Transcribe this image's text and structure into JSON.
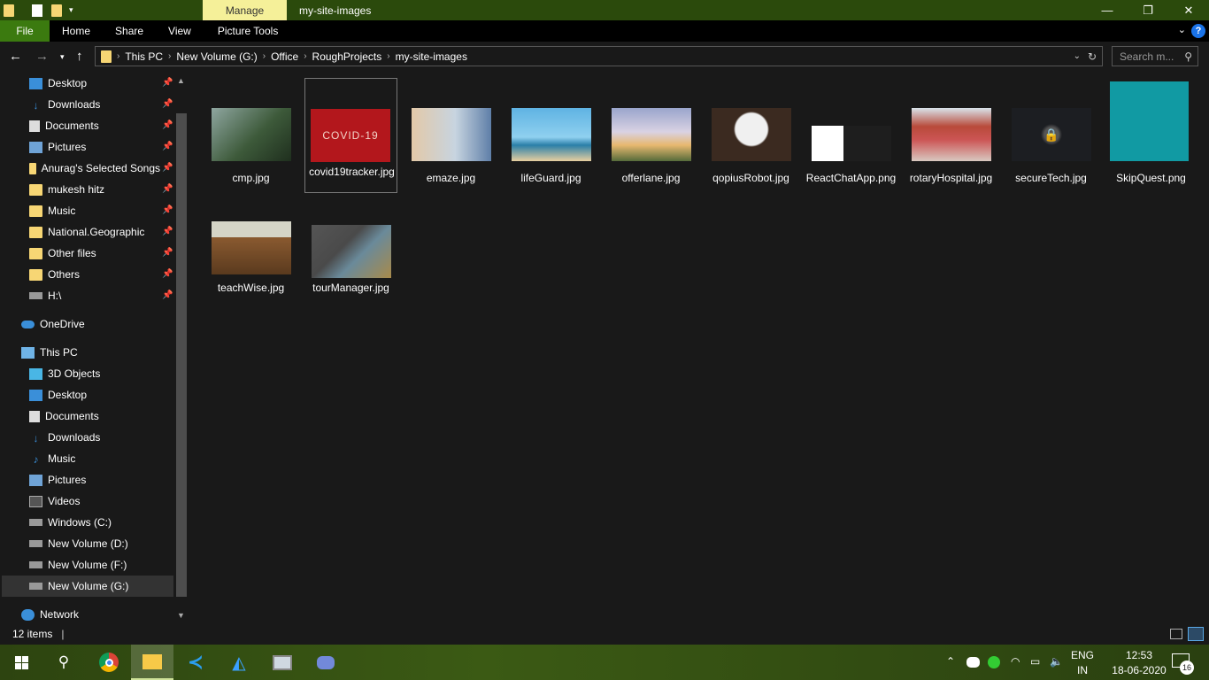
{
  "window": {
    "title": "my-site-images",
    "contextual_tab": "Manage",
    "controls": {
      "minimize": "—",
      "maximize": "❐",
      "close": "✕"
    }
  },
  "ribbon": {
    "tabs": [
      "File",
      "Home",
      "Share",
      "View",
      "Picture Tools"
    ],
    "help": "?"
  },
  "address": {
    "crumbs": [
      "This PC",
      "New Volume (G:)",
      "Office",
      "RoughProjects",
      "my-site-images"
    ],
    "search_placeholder": "Search m..."
  },
  "sidebar": {
    "quick_access": [
      {
        "label": "Desktop",
        "icon": "desktop-icon",
        "pinned": true
      },
      {
        "label": "Downloads",
        "icon": "download-icon",
        "pinned": true
      },
      {
        "label": "Documents",
        "icon": "document-icon",
        "pinned": true
      },
      {
        "label": "Pictures",
        "icon": "pictures-icon",
        "pinned": true
      },
      {
        "label": "Anurag's Selected Songs",
        "icon": "folder-icon",
        "pinned": true
      },
      {
        "label": "mukesh hitz",
        "icon": "folder-icon",
        "pinned": true
      },
      {
        "label": "Music",
        "icon": "folder-icon",
        "pinned": true
      },
      {
        "label": "National.Geographic",
        "icon": "folder-icon",
        "pinned": true
      },
      {
        "label": "Other files",
        "icon": "folder-icon",
        "pinned": true
      },
      {
        "label": "Others",
        "icon": "folder-icon",
        "pinned": true
      },
      {
        "label": "H:\\",
        "icon": "network-drive-icon",
        "pinned": true
      }
    ],
    "onedrive": "OneDrive",
    "this_pc": "This PC",
    "this_pc_items": [
      {
        "label": "3D Objects",
        "icon": "3d-objects-icon"
      },
      {
        "label": "Desktop",
        "icon": "desktop-icon"
      },
      {
        "label": "Documents",
        "icon": "document-icon"
      },
      {
        "label": "Downloads",
        "icon": "download-icon"
      },
      {
        "label": "Music",
        "icon": "music-icon"
      },
      {
        "label": "Pictures",
        "icon": "pictures-icon"
      },
      {
        "label": "Videos",
        "icon": "videos-icon"
      },
      {
        "label": "Windows (C:)",
        "icon": "drive-icon"
      },
      {
        "label": "New Volume (D:)",
        "icon": "drive-icon"
      },
      {
        "label": "New Volume (F:)",
        "icon": "drive-icon"
      },
      {
        "label": "New Volume (G:)",
        "icon": "drive-icon",
        "selected": true
      }
    ],
    "network": "Network"
  },
  "files": [
    {
      "name": "cmp.jpg",
      "thumb": "#3d5a3a"
    },
    {
      "name": "covid19tracker.jpg",
      "thumb": "#b3171c",
      "thumb_text": "COVID-19"
    },
    {
      "name": "emaze.jpg",
      "thumb": "#8aa9c7"
    },
    {
      "name": "lifeGuard.jpg",
      "thumb": "#3b9bc9"
    },
    {
      "name": "offerlane.jpg",
      "thumb": "#6f7fa8"
    },
    {
      "name": "qopiusRobot.jpg",
      "thumb": "#3b2a20"
    },
    {
      "name": "ReactChatApp.png",
      "thumb": "#1e1e1e"
    },
    {
      "name": "rotaryHospital.jpg",
      "thumb": "#b84a3a"
    },
    {
      "name": "secureTech.jpg",
      "thumb": "#1c1e22"
    },
    {
      "name": "SkipQuest.png",
      "thumb": "#119aa3"
    },
    {
      "name": "teachWise.jpg",
      "thumb": "#8a5a30"
    },
    {
      "name": "tourManager.jpg",
      "thumb": "#4a4a4a"
    }
  ],
  "status": {
    "count": "12 items"
  },
  "taskbar": {
    "language": "ENG",
    "region": "IN",
    "time": "12:53",
    "date": "18-06-2020",
    "notifications": "16"
  }
}
